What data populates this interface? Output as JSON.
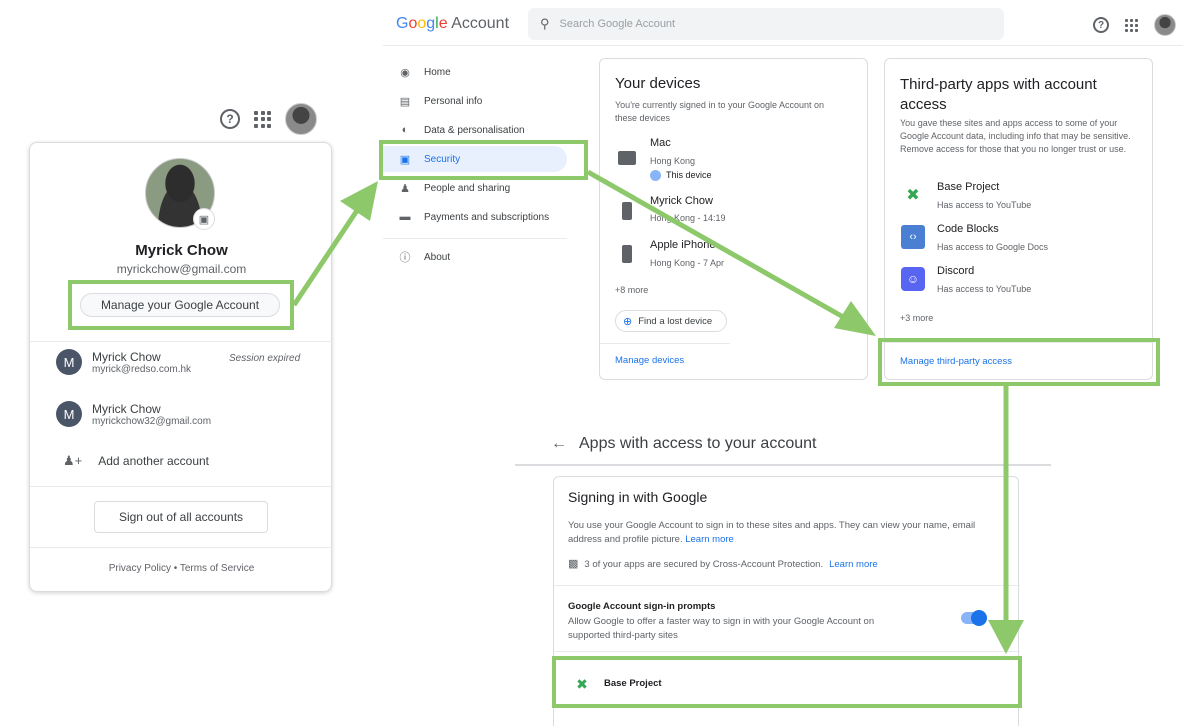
{
  "popup": {
    "help_label": "?",
    "name": "Myrick Chow",
    "email": "myrickchow@gmail.com",
    "manage_button": "Manage your Google Account",
    "accounts": [
      {
        "initial": "M",
        "name": "Myrick Chow",
        "email": "myrick@redso.com.hk",
        "status": "Session expired"
      },
      {
        "initial": "M",
        "name": "Myrick Chow",
        "email": "myrickchow32@gmail.com"
      }
    ],
    "add_account": "Add another account",
    "sign_out": "Sign out of all accounts",
    "footer": "Privacy Policy  •  Terms of Service"
  },
  "header": {
    "logo": "Google Account",
    "search_placeholder": "Search Google Account"
  },
  "nav": [
    {
      "label": "Home",
      "icon": "home-icon"
    },
    {
      "label": "Personal info",
      "icon": "personal-info-icon"
    },
    {
      "label": "Data & personalisation",
      "icon": "toggle-icon"
    },
    {
      "label": "Security",
      "icon": "lock-icon",
      "active": true
    },
    {
      "label": "People and sharing",
      "icon": "people-icon"
    },
    {
      "label": "Payments and subscriptions",
      "icon": "card-icon"
    },
    {
      "label": "About",
      "icon": "info-icon"
    }
  ],
  "devices": {
    "title": "Your devices",
    "subtitle": "You're currently signed in to your Google Account on these devices",
    "items": [
      {
        "name": "Mac",
        "detail": "Hong Kong",
        "badge": "This device"
      },
      {
        "name": "Myrick Chow",
        "detail": "Hong Kong - 14:19"
      },
      {
        "name": "Apple iPhone",
        "detail": "Hong Kong - 7 Apr"
      }
    ],
    "more": "+8 more",
    "find_button": "Find a lost device",
    "manage_link": "Manage devices"
  },
  "third_party": {
    "title": "Third-party apps with account access",
    "description": "You gave these sites and apps access to some of your Google Account data, including info that may be sensitive. Remove access for those that you no longer trust or use.",
    "apps": [
      {
        "name": "Base Project",
        "detail": "Has access to YouTube"
      },
      {
        "name": "Code Blocks",
        "detail": "Has access to Google Docs"
      },
      {
        "name": "Discord",
        "detail": "Has access to YouTube"
      }
    ],
    "more": "+3 more",
    "manage_link": "Manage third-party access"
  },
  "apps_page": {
    "title": "Apps with access to your account",
    "signin_title": "Signing in with Google",
    "signin_desc": "You use your Google Account to sign in to these sites and apps. They can view your name, email address and profile picture.",
    "learn_more": "Learn more",
    "protection": "3 of your apps are secured by Cross-Account Protection.",
    "protection_link": "Learn more",
    "prompts_title": "Google Account sign-in prompts",
    "prompts_desc": "Allow Google to offer a faster way to sign in with your Google Account on supported third-party sites",
    "app_row": "Base Project"
  },
  "colors": {
    "highlight": "#8dc96b",
    "link": "#1a73e8"
  }
}
